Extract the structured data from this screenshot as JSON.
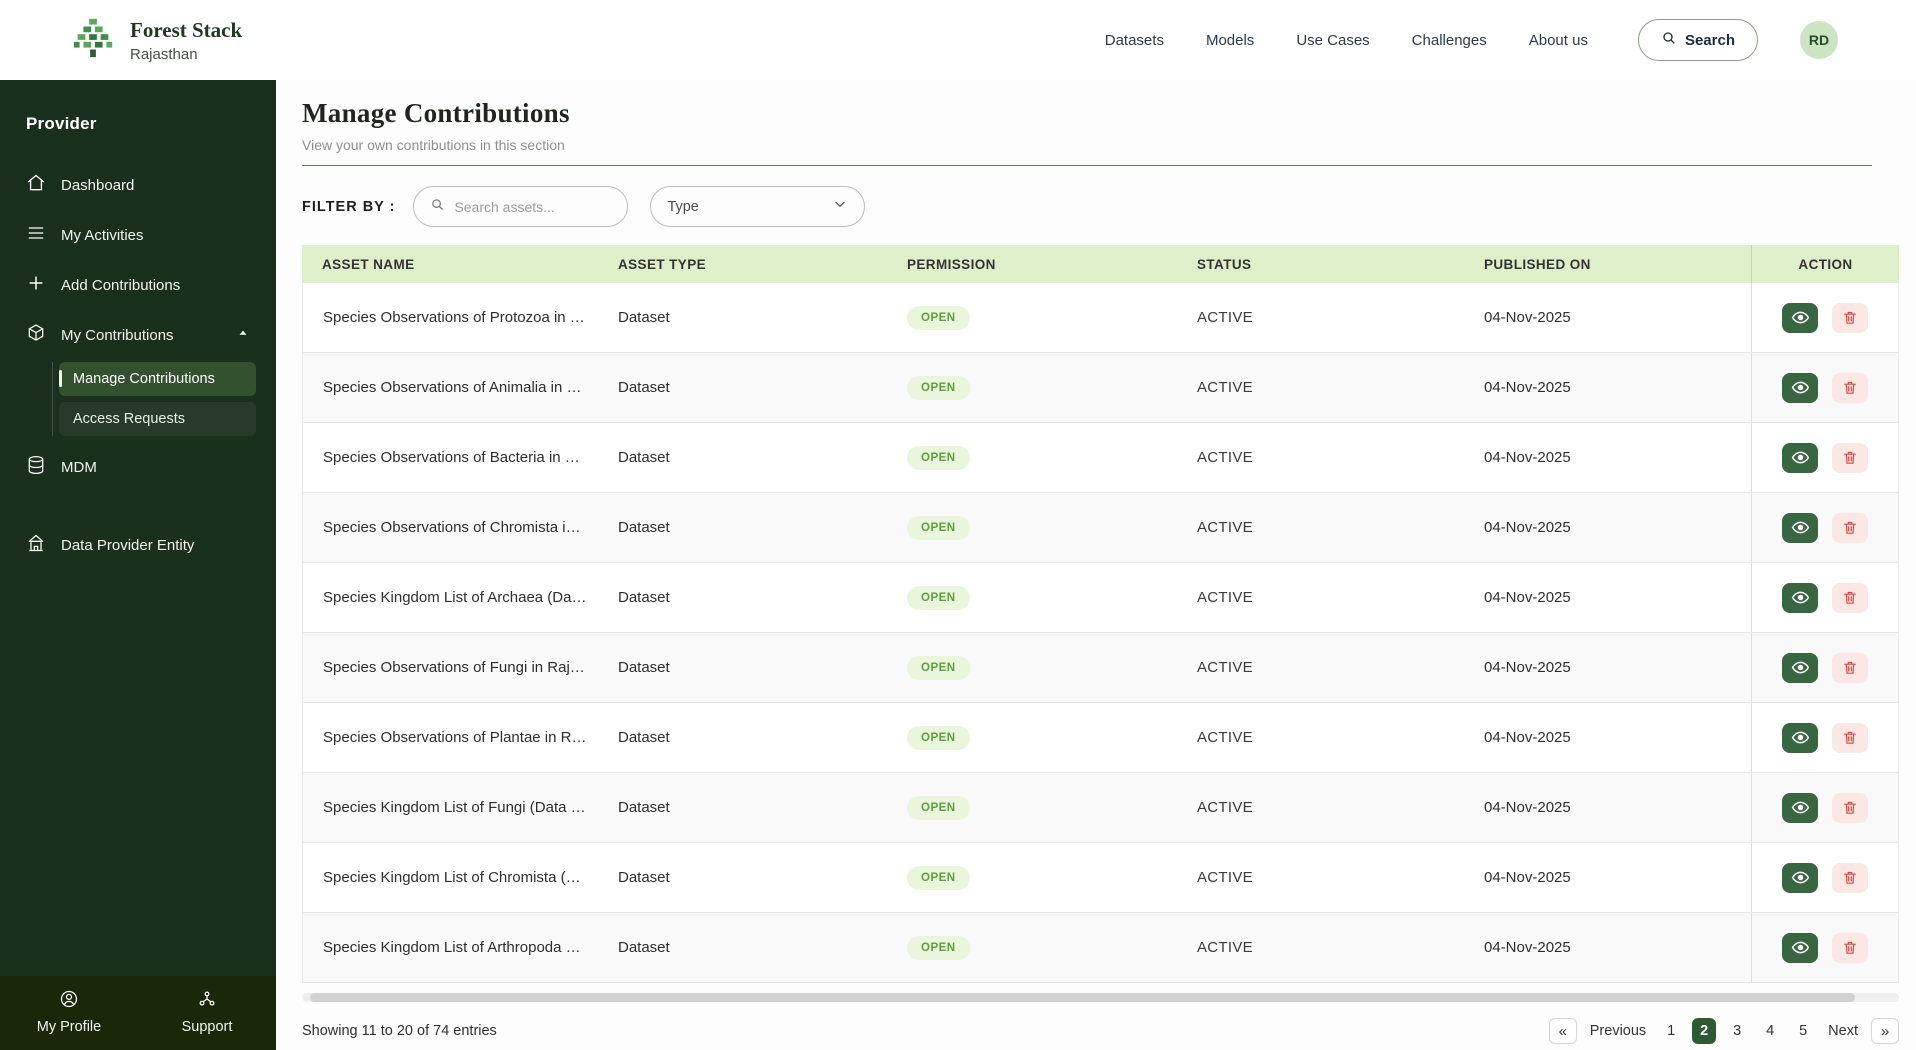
{
  "brand": {
    "name": "Forest Stack",
    "region": "Rajasthan"
  },
  "topnav": {
    "items": [
      "Datasets",
      "Models",
      "Use Cases",
      "Challenges",
      "About us"
    ],
    "search_label": "Search",
    "avatar_initials": "RD"
  },
  "sidebar": {
    "section_label": "Provider",
    "items": [
      "Dashboard",
      "My Activities",
      "Add Contributions",
      "My Contributions",
      "MDM",
      "Data Provider Entity"
    ],
    "subitems": [
      "Manage Contributions",
      "Access Requests"
    ],
    "footer_items": [
      "My Profile",
      "Support"
    ]
  },
  "page": {
    "title": "Manage Contributions",
    "subtitle": "View your own contributions in this section",
    "filter_label": "FILTER BY :",
    "search_placeholder": "Search assets...",
    "type_label": "Type"
  },
  "table": {
    "columns": [
      "ASSET NAME",
      "ASSET TYPE",
      "PERMISSION",
      "STATUS",
      "PUBLISHED ON",
      "ACTION"
    ],
    "rows": [
      {
        "name": "Species Observations of Protozoa in …",
        "type": "Dataset",
        "permission": "OPEN",
        "status": "ACTIVE",
        "published": "04-Nov-2025"
      },
      {
        "name": "Species Observations of Animalia in …",
        "type": "Dataset",
        "permission": "OPEN",
        "status": "ACTIVE",
        "published": "04-Nov-2025"
      },
      {
        "name": "Species Observations of Bacteria in …",
        "type": "Dataset",
        "permission": "OPEN",
        "status": "ACTIVE",
        "published": "04-Nov-2025"
      },
      {
        "name": "Species Observations of Chromista i…",
        "type": "Dataset",
        "permission": "OPEN",
        "status": "ACTIVE",
        "published": "04-Nov-2025"
      },
      {
        "name": "Species Kingdom List of Archaea (Da…",
        "type": "Dataset",
        "permission": "OPEN",
        "status": "ACTIVE",
        "published": "04-Nov-2025"
      },
      {
        "name": "Species Observations of Fungi in Raj…",
        "type": "Dataset",
        "permission": "OPEN",
        "status": "ACTIVE",
        "published": "04-Nov-2025"
      },
      {
        "name": "Species Observations of Plantae in R…",
        "type": "Dataset",
        "permission": "OPEN",
        "status": "ACTIVE",
        "published": "04-Nov-2025"
      },
      {
        "name": "Species Kingdom List of Fungi (Data …",
        "type": "Dataset",
        "permission": "OPEN",
        "status": "ACTIVE",
        "published": "04-Nov-2025"
      },
      {
        "name": "Species Kingdom List of Chromista (…",
        "type": "Dataset",
        "permission": "OPEN",
        "status": "ACTIVE",
        "published": "04-Nov-2025"
      },
      {
        "name": "Species Kingdom List of Arthropoda …",
        "type": "Dataset",
        "permission": "OPEN",
        "status": "ACTIVE",
        "published": "04-Nov-2025"
      }
    ]
  },
  "footer": {
    "showing": "Showing 11 to 20 of 74 entries",
    "pagination": {
      "first": "«",
      "prev": "Previous",
      "pages": [
        "1",
        "2",
        "3",
        "4",
        "5"
      ],
      "active_page": "2",
      "next": "Next",
      "last": "»"
    }
  },
  "colors": {
    "sidebar_green": "#1b2f1d",
    "table_header_green": "#def0ca",
    "accent_green": "#386641",
    "badge_text_green": "#5f9e3e",
    "danger_red": "#d84b40"
  }
}
